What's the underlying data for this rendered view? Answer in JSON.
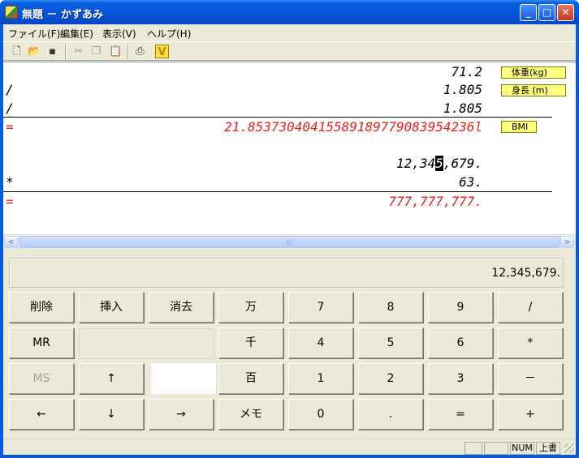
{
  "window": {
    "title": "無題 － かずあみ"
  },
  "titlebar_buttons": {
    "minimize": "_",
    "maximize": "□",
    "close": "✕"
  },
  "menu": [
    "ファイル(F)",
    "編集(E)",
    "表示(V)",
    "ヘルプ(H)"
  ],
  "toolbar": {
    "icons": [
      "new-file-icon",
      "open-folder-icon",
      "save-icon",
      "cut-icon",
      "copy-icon",
      "paste-icon",
      "print-icon",
      "check-v-icon"
    ],
    "glyphs": {
      "new": "🗋",
      "open": "📂",
      "save": "▪",
      "cut": "✂",
      "copy": "❐",
      "paste": "📋",
      "print": "⎙",
      "check": "V"
    }
  },
  "document": {
    "block1": [
      {
        "op": "",
        "value": "71.2",
        "tag": "体重(kg)"
      },
      {
        "op": "/",
        "value": "1.805",
        "tag": "身長 (m)"
      },
      {
        "op": "/",
        "value": "1.805",
        "tag": ""
      },
      {
        "op": "=",
        "value": "21.85373040415589189779083954236l",
        "tag": "BMI"
      }
    ],
    "block2": [
      {
        "op": "",
        "value_pre": "12,34",
        "value_caret": "5",
        "value_post": ",679."
      },
      {
        "op": "*",
        "value": "63."
      },
      {
        "op": "=",
        "value": "777,777,777."
      }
    ]
  },
  "scrollbar": {
    "left": "<",
    "right": ">",
    "thumb_grip": "|||"
  },
  "display": {
    "value": "12,345,679."
  },
  "keys": {
    "row1": [
      "削除",
      "挿入",
      "消去",
      "万",
      "7",
      "8",
      "9",
      "/"
    ],
    "row2": [
      "MR",
      "千",
      "4",
      "5",
      "6",
      "*"
    ],
    "row3": [
      "MS",
      "↑",
      "百",
      "1",
      "2",
      "3",
      "－"
    ],
    "row4": [
      "←",
      "↓",
      "→",
      "メモ",
      "0",
      ".",
      "=",
      "+"
    ]
  },
  "status": {
    "num": "NUM",
    "overwrite": "上書"
  },
  "colors": {
    "result_red": "#e8201a",
    "tag_yellow": "#ffff80"
  }
}
